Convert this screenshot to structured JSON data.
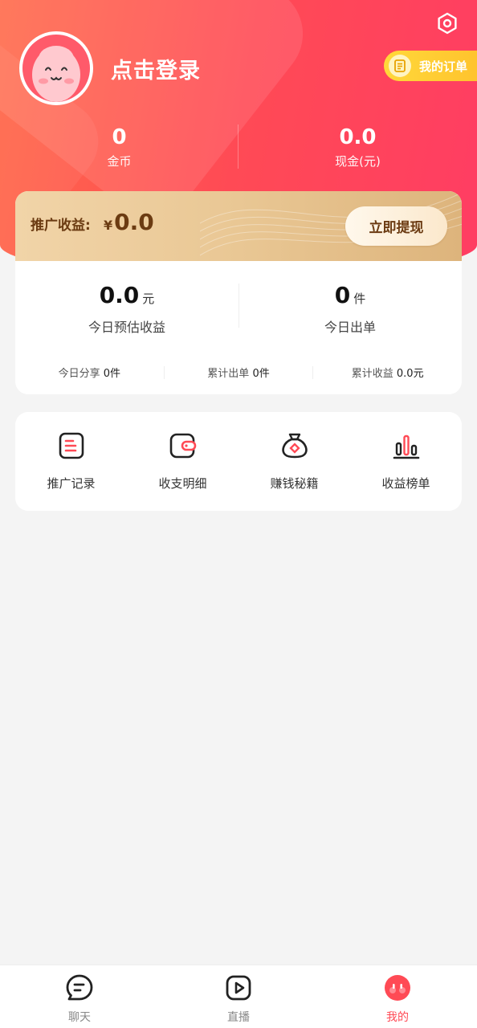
{
  "header": {
    "login_text": "点击登录",
    "orders_label": "我的订单",
    "stats": [
      {
        "value": "0",
        "label": "金币"
      },
      {
        "value": "0.0",
        "label": "现金(元)"
      }
    ]
  },
  "earnings": {
    "label": "推广收益:",
    "currency": "¥",
    "amount": "0.0",
    "withdraw_label": "立即提现",
    "today_estimate": {
      "value": "0.0",
      "unit": "元",
      "label": "今日预估收益"
    },
    "today_orders": {
      "value": "0",
      "unit": "件",
      "label": "今日出单"
    },
    "mini_stats": [
      {
        "label": "今日分享",
        "value": "0件"
      },
      {
        "label": "累计出单",
        "value": "0件"
      },
      {
        "label": "累计收益",
        "value": "0.0元"
      }
    ]
  },
  "tools": [
    {
      "label": "推广记录",
      "icon": "list-doc-icon"
    },
    {
      "label": "收支明细",
      "icon": "wallet-icon"
    },
    {
      "label": "赚钱秘籍",
      "icon": "money-bag-icon"
    },
    {
      "label": "收益榜单",
      "icon": "bar-chart-icon"
    }
  ],
  "bottom_nav": [
    {
      "label": "聊天",
      "icon": "chat-icon",
      "active": false
    },
    {
      "label": "直播",
      "icon": "live-play-icon",
      "active": false
    },
    {
      "label": "我的",
      "icon": "profile-face-icon",
      "active": true
    }
  ],
  "colors": {
    "accent": "#ff4a55",
    "gold_text": "#6b3b12",
    "orders_pill": "#ffc12c"
  }
}
